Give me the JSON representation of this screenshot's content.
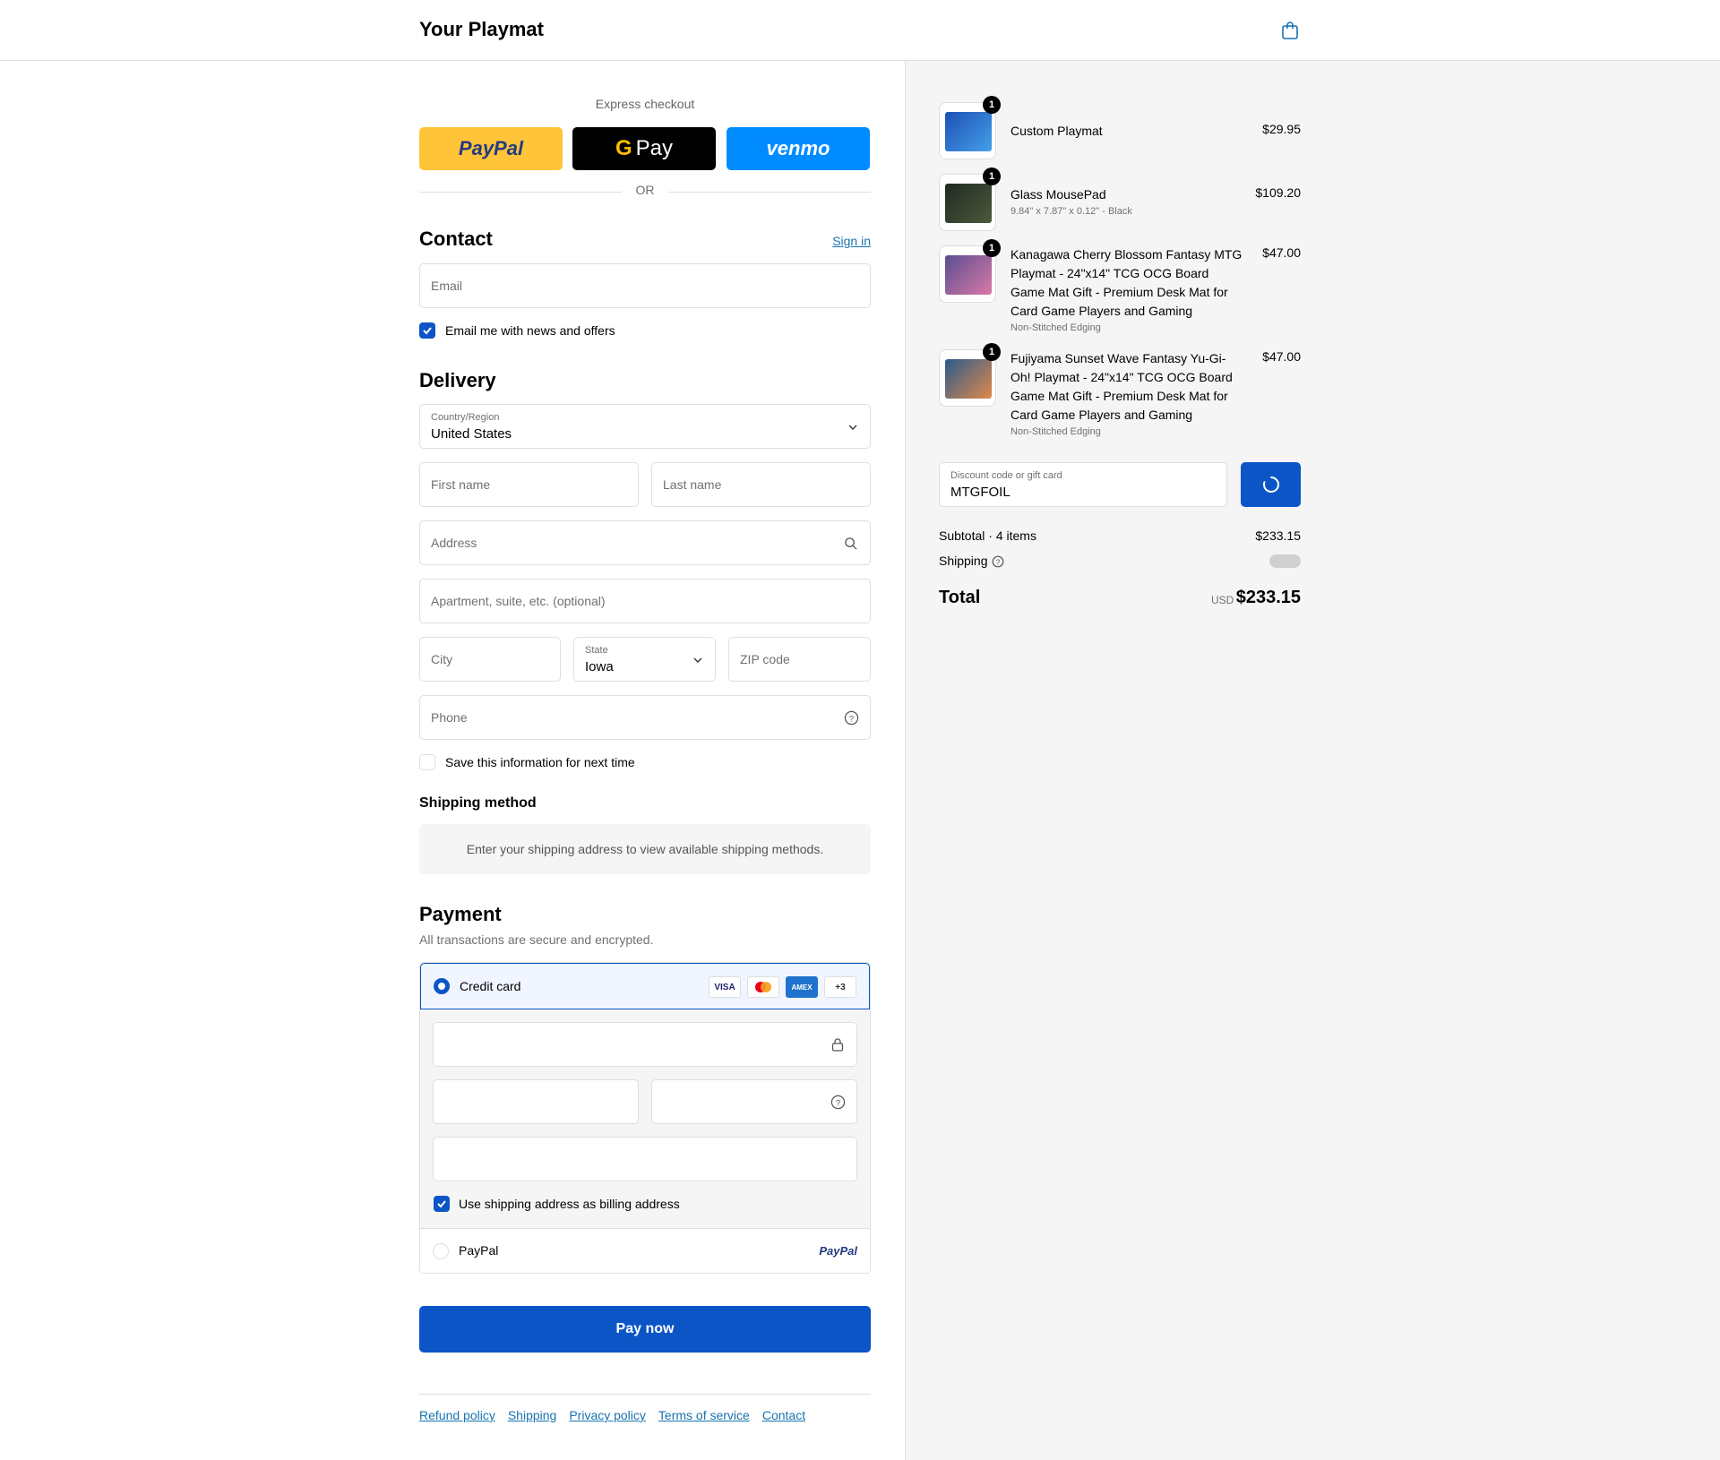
{
  "header": {
    "brand": "Your Playmat"
  },
  "express": {
    "label": "Express checkout",
    "paypal": "PayPal",
    "gpay": "Pay",
    "venmo": "venmo",
    "or": "OR"
  },
  "contact": {
    "heading": "Contact",
    "sign_in": "Sign in",
    "email_placeholder": "Email",
    "news_label": "Email me with news and offers"
  },
  "delivery": {
    "heading": "Delivery",
    "country_label": "Country/Region",
    "country_value": "United States",
    "first_name": "First name",
    "last_name": "Last name",
    "address": "Address",
    "apartment": "Apartment, suite, etc. (optional)",
    "city": "City",
    "state_label": "State",
    "state_value": "Iowa",
    "zip": "ZIP code",
    "phone": "Phone",
    "save_label": "Save this information for next time"
  },
  "shipping_method": {
    "heading": "Shipping method",
    "info": "Enter your shipping address to view available shipping methods."
  },
  "payment": {
    "heading": "Payment",
    "subtitle": "All transactions are secure and encrypted.",
    "credit_card": "Credit card",
    "cards": [
      "VISA",
      "AMEX",
      "+3"
    ],
    "billing_label": "Use shipping address as billing address",
    "paypal_option": "PayPal",
    "paypal_logo": "PayPal"
  },
  "pay_now": "Pay now",
  "footer": {
    "links": [
      "Refund policy",
      "Shipping",
      "Privacy policy",
      "Terms of service",
      "Contact"
    ]
  },
  "summary": {
    "items": [
      {
        "name": "Custom Playmat",
        "sub": "",
        "price": "$29.95",
        "qty": "1",
        "color": "#1d4fb5"
      },
      {
        "name": "Glass MousePad",
        "sub": "9.84\" x 7.87\" x 0.12\" - Black",
        "price": "$109.20",
        "qty": "1",
        "color": "#1e2a22"
      },
      {
        "name": "Kanagawa Cherry Blossom Fantasy MTG Playmat - 24\"x14\" TCG OCG Board Game Mat Gift - Premium Desk Mat for Card Game Players and Gaming",
        "sub": "Non-Stitched Edging",
        "price": "$47.00",
        "qty": "1",
        "color": "#b86a9a"
      },
      {
        "name": "Fujiyama Sunset Wave Fantasy Yu-Gi-Oh! Playmat - 24\"x14\" TCG OCG Board Game Mat Gift - Premium Desk Mat for Card Game Players and Gaming",
        "sub": "Non-Stitched Edging",
        "price": "$47.00",
        "qty": "1",
        "color": "#c0773e"
      }
    ],
    "discount_label": "Discount code or gift card",
    "discount_value": "MTGFOIL",
    "subtotal_label": "Subtotal · 4 items",
    "subtotal_value": "$233.15",
    "shipping_label": "Shipping",
    "total_label": "Total",
    "currency": "USD",
    "total_value": "$233.15"
  }
}
